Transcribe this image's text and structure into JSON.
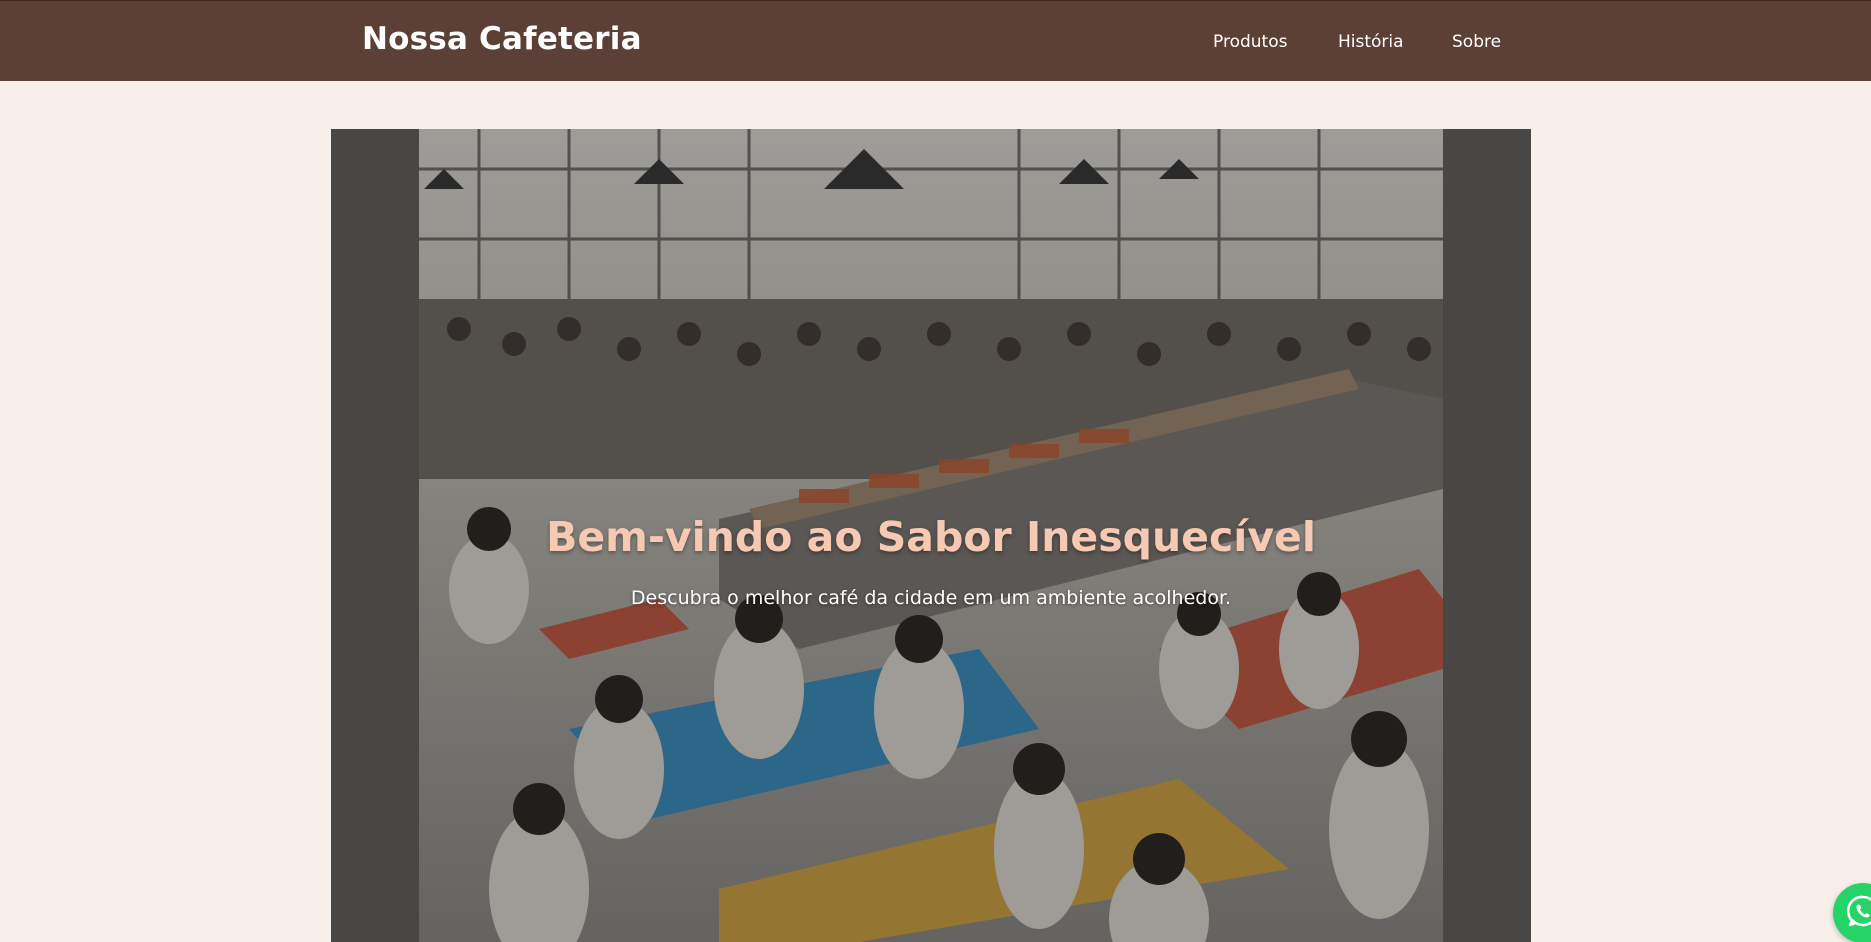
{
  "header": {
    "brand": "Nossa Cafeteria",
    "nav": [
      {
        "label": "Produtos"
      },
      {
        "label": "História"
      },
      {
        "label": "Sobre"
      }
    ]
  },
  "hero": {
    "title": "Bem-vindo ao Sabor Inesquecível",
    "subtitle": "Descubra o melhor café da cidade em um ambiente acolhedor.",
    "image": "cafeteria-photo"
  },
  "floating": {
    "icon": "whatsapp-icon"
  },
  "colors": {
    "navbar": "#5d4035",
    "page_background": "#f7f0ea",
    "hero_title": "#f6c9b3",
    "whatsapp": "#25d366"
  }
}
